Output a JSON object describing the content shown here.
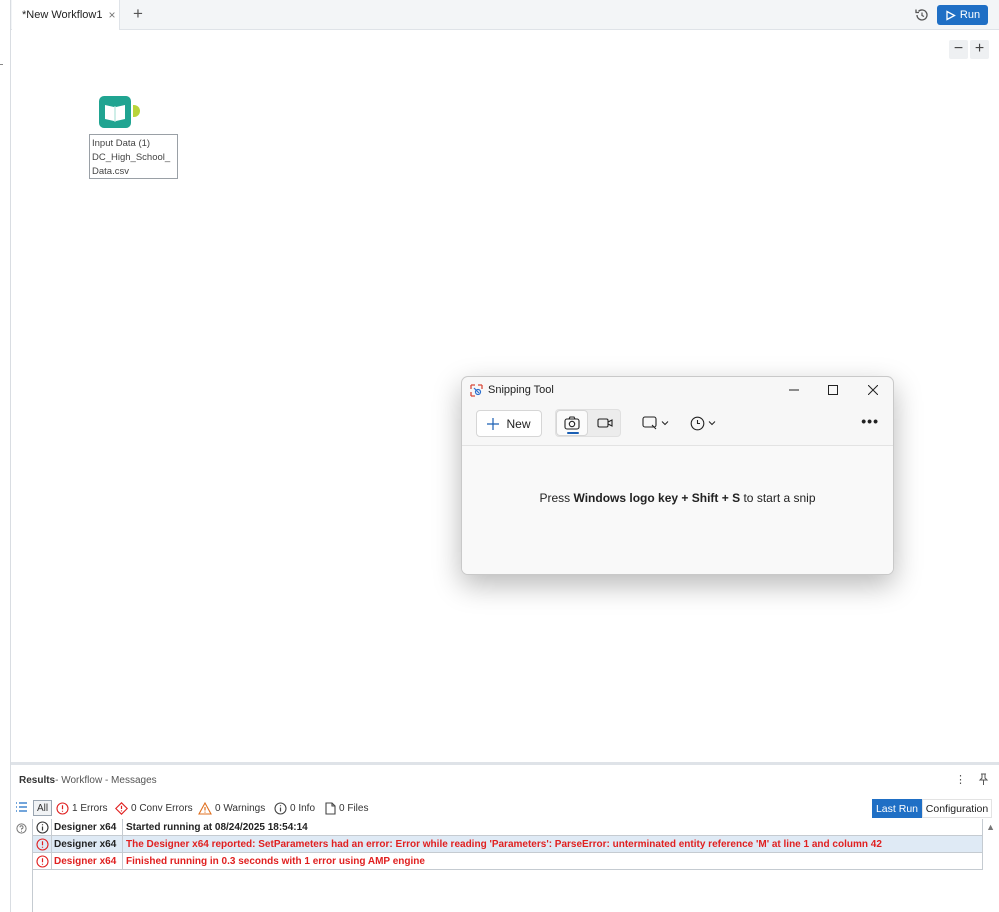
{
  "tabs": [
    {
      "label": "*New Workflow1",
      "close": "×"
    }
  ],
  "toolbar": {
    "add_tab": "+",
    "run_label": "Run"
  },
  "zoom": {
    "out": "−",
    "in": "+"
  },
  "canvas": {
    "tool": {
      "label_line1": "Input Data (1)",
      "label_line2": "DC_High_School_",
      "label_line3": "Data.csv",
      "icon": "book-icon",
      "color": "#20a491"
    }
  },
  "snipping_tool": {
    "title": "Snipping Tool",
    "new_label": "New",
    "msg_prefix": "Press ",
    "msg_key1": "Windows logo key",
    "msg_plus1": " + ",
    "msg_key2": "Shift",
    "msg_plus2": " + ",
    "msg_key3": "S",
    "msg_suffix": " to start a snip"
  },
  "results": {
    "title": "Results",
    "subtitle": " - Workflow - Messages",
    "filters": {
      "all": "All",
      "errors": "1 Errors",
      "conv_errors": "0 Conv Errors",
      "warnings": "0 Warnings",
      "info": "0 Info",
      "files": "0 Files"
    },
    "last_run": "Last Run",
    "configuration": "Configuration",
    "messages": [
      {
        "source": "Designer x64",
        "text": "Started running at 08/24/2025 18:54:14",
        "type": "info"
      },
      {
        "source": "Designer x64",
        "text": "The Designer x64 reported: SetParameters had an error: Error while reading 'Parameters': ParseError: unterminated entity reference 'M' at line 1 and column 42",
        "type": "error"
      },
      {
        "source": "Designer x64",
        "text": "Finished running in 0.3 seconds with 1 error using AMP engine",
        "type": "error"
      }
    ]
  },
  "colors": {
    "accent": "#1f6fc5",
    "error": "#e02020",
    "tool": "#20a491"
  }
}
